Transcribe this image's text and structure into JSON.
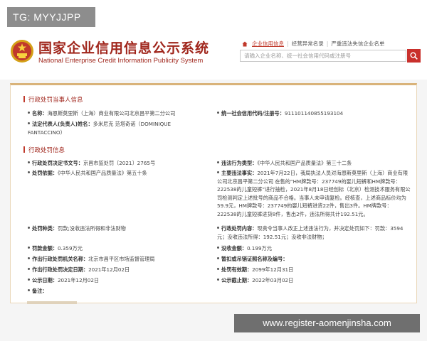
{
  "badge": "TG: MYYJJPP",
  "header": {
    "title": "国家企业信用信息公示系统",
    "subtitle": "National Enterprise Credit Information Publicity System",
    "nav": [
      "企业信用信息",
      "经营异常名录",
      "严重违法失信企业名单"
    ],
    "search_placeholder": "请输入企业名称、统一社会信用代码或注册号"
  },
  "sections": {
    "party_title": "行政处罚当事人信息",
    "penalty_title": "行政处罚信息"
  },
  "party": {
    "name_label": "名称：",
    "name": "海恩斯莫里斯（上海）商业有限公司北京昌平第二分公司",
    "code_label": "统一社会信用代码/注册号：",
    "code": "911101140855193104",
    "rep_label": "法定代表人(负责人)姓名：",
    "rep": "多米尼克 范塔奇诺（DOMINIQUE FANTACCINO）"
  },
  "penalty": {
    "doc_no_label": "行政处罚决定书文号：",
    "doc_no": "京昌市监处罚〔2021〕2765号",
    "violation_type_label": "违法行为类型：",
    "violation_type": "《中华人民共和国产品质量法》第三十二条",
    "basis_label": "处罚依据：",
    "basis": "《中华人民共和国产品质量法》第五十条",
    "facts_label": "主要违法事实：",
    "facts": "2021年7月22日，我局执法人员对海恩斯莫里斯（上海）商业有限公司北京昌平第二分公司 在售的“HM牌款号：237749的婴儿短裤和HM牌款号：222538的儿童短裤”进行抽检，2021年8月18日经创标（北京）检测技术服务有限公司检测判定上述批号的商品不合格。当事人未申请复检。经核查，上述商品标价均为59.9元，HM牌款号：237749的婴儿短裤进货22件，售出3件。HM牌款号：222538的儿童短裤进货8件，售出2件，违法所得共计192.51元。",
    "kind_label": "处罚种类：",
    "kind": "罚款;没收违法所得和非法财物",
    "content_label": "行政处罚内容：",
    "content": "现责令当事人改正上述违法行为，并决定处罚如下：罚款：3594元；没收违法所得：192.51元；没收非法财物；",
    "fine_label": "罚款金额：",
    "fine": "0.359万元",
    "confiscated_label": "没收金额：",
    "confiscated": "0.199万元",
    "authority_label": "作出行政处罚机关名称：",
    "authority": "北京市昌平区市场监督管理局",
    "revoked_label": "暂扣或吊销证照名称及编号：",
    "revoked": "",
    "decision_date_label": "作出行政处罚决定日期：",
    "decision_date": "2021年12月02日",
    "valid_until_label": "处罚有效期：",
    "valid_until": "2099年12月31日",
    "pub_date_label": "公示日期：",
    "pub_date": "2021年12月02日",
    "pub_end_label": "公示截止期：",
    "pub_end": "2022年03月02日",
    "note_label": "备注："
  },
  "watermark": "www.register-aomenjinsha.com",
  "colors": {
    "brand": "#a0261c",
    "accent": "#c9302c",
    "panel_border": "#d9b37a"
  }
}
